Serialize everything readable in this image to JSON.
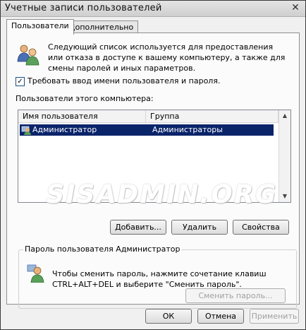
{
  "window": {
    "title": "Учетные записи пользователей",
    "close_glyph": "✕"
  },
  "tabs": [
    {
      "label": "Пользователи",
      "active": true
    },
    {
      "label": "Дополнительно",
      "active": false
    }
  ],
  "users_tab": {
    "description": "Следующий список используется для предоставления или отказа в доступе к вашему компьютеру, а также для смены паролей и иных параметров.",
    "require_login_checkbox": {
      "label": "Требовать ввод имени пользователя и пароля.",
      "checked": true,
      "mark": "✓"
    },
    "users_label": "Пользователи этого компьютера:",
    "columns": [
      "Имя пользователя",
      "Группа"
    ],
    "rows": [
      {
        "name": "Администратор",
        "group": "Администраторы",
        "selected": true
      }
    ],
    "buttons": {
      "add": "Добавить...",
      "remove": "Удалить",
      "properties": "Свойства"
    },
    "password_group": {
      "title": "Пароль пользователя Администратор",
      "text": "Чтобы сменить пароль, нажмите сочетание клавиш CTRL+ALT+DEL и выберите \"Сменить пароль\".",
      "button": "Сменить пароль...",
      "button_enabled": false
    }
  },
  "watermark": "SISADMIN.ORG",
  "dialog_buttons": {
    "ok": "ОК",
    "cancel": "Отмена",
    "apply": "Применить"
  },
  "icons": {
    "users_icon": "users-icon",
    "user_row_icon": "user-icon",
    "password_icon": "user-key-icon"
  },
  "colors": {
    "selection": "#0a246a",
    "panel": "#fbfbfb"
  }
}
